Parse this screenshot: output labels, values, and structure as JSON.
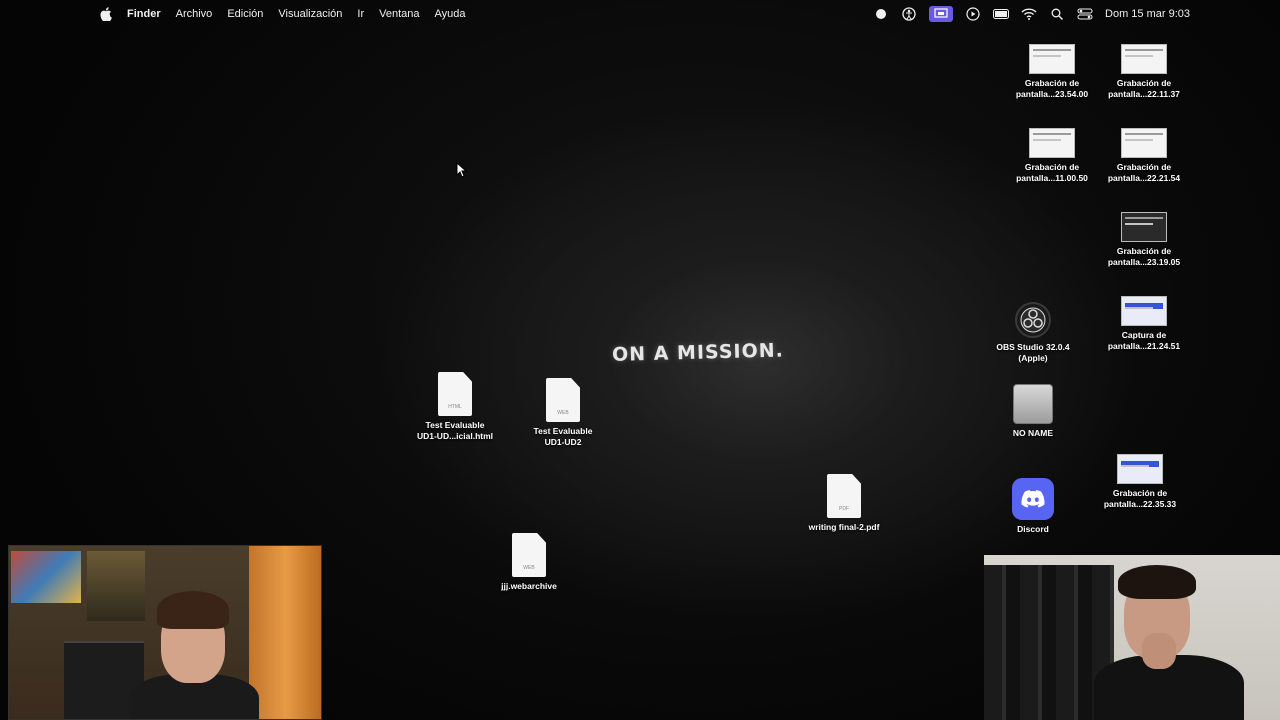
{
  "menubar": {
    "app_name": "Finder",
    "menus": [
      "Archivo",
      "Edición",
      "Visualización",
      "Ir",
      "Ventana",
      "Ayuda"
    ],
    "clock": "Dom 15 mar 9:03",
    "tray_icons": [
      "record-icon",
      "accessibility-icon",
      "screen-mirroring-icon",
      "play-icon",
      "battery-icon",
      "wifi-icon",
      "search-icon",
      "control-center-icon"
    ]
  },
  "wallpaper": {
    "text": "ON A MISSION."
  },
  "desktop_icons": {
    "screenshot1": "Grabación de\npantalla...23.54.00",
    "screenshot2": "Grabación de\npantalla...22.11.37",
    "screenshot3": "Grabación de\npantalla...11.00.50",
    "screenshot4": "Grabación de\npantalla...22.21.54",
    "screenshot5": "Grabación de\npantalla...23.19.05",
    "obs": "OBS Studio 32.0.4\n(Apple)",
    "capture": "Captura de\npantalla...21.24.51",
    "drive": "NO NAME",
    "discord": "Discord",
    "screenshot6": "Grabación de\npantalla...22.35.33",
    "test_html": "Test Evaluable\nUD1-UD...icial.html",
    "test_web": "Test Evaluable\nUD1-UD2",
    "writing_pdf": "writing final-2.pdf",
    "jjj": "jjj.webarchive"
  },
  "file_types": {
    "html": "HTML",
    "web": "WEB",
    "pdf": "PDF"
  },
  "colors": {
    "menubar_accent": "#6a5ae0",
    "discord": "#5865f2",
    "curtain": "#e89b44"
  }
}
